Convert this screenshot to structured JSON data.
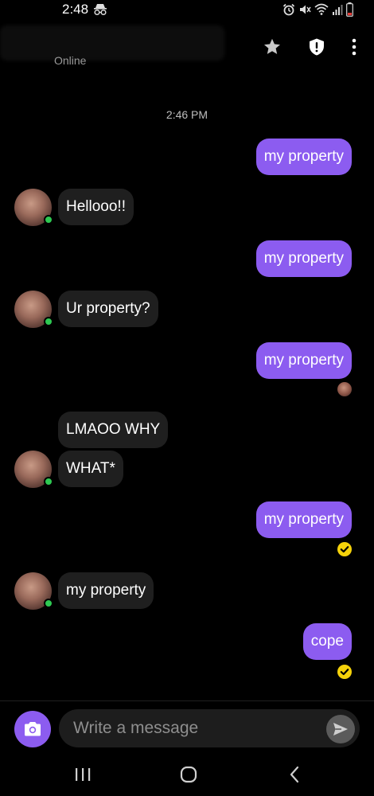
{
  "status_bar": {
    "time": "2:48"
  },
  "header": {
    "contact_status": "Online"
  },
  "chat": {
    "timestamp": "2:46 PM",
    "messages": [
      {
        "from": "me",
        "text": "my property"
      },
      {
        "from": "them",
        "text": "Hellooo!!"
      },
      {
        "from": "me",
        "text": "my property"
      },
      {
        "from": "them",
        "text": "Ur property?"
      },
      {
        "from": "me",
        "text": "my property"
      },
      {
        "from": "them",
        "text": "LMAOO WHY"
      },
      {
        "from": "them",
        "text": "WHAT*"
      },
      {
        "from": "me",
        "text": "my property"
      },
      {
        "from": "them",
        "text": "my property"
      },
      {
        "from": "me",
        "text": "cope"
      }
    ]
  },
  "composer": {
    "placeholder": "Write a message"
  },
  "colors": {
    "accent": "#8c5cf0",
    "incoming_bubble": "#1f1f1f",
    "online": "#2ec952",
    "seen": "#f5d20a"
  }
}
